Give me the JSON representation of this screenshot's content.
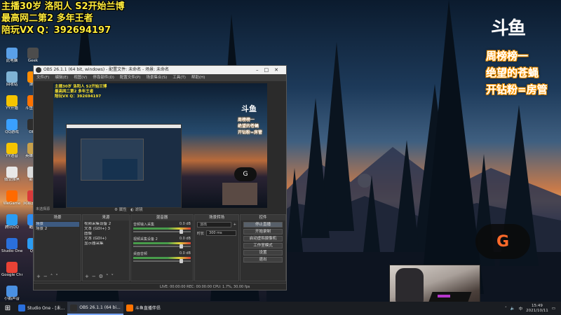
{
  "overlay": {
    "line1": "主播30岁 洛阳人 S2开始兰博",
    "line2": "最高网二第2 多年王者",
    "line3": "陪玩VX Q：392694197",
    "logo": "斗鱼",
    "right_line1": "周榜榜一",
    "right_line2": "绝望的苍蝇",
    "right_line3": "开钻粉=房管",
    "badge_glyph": "G"
  },
  "desktop_icons": [
    {
      "label": "此电脑",
      "color": "#5aa0e8"
    },
    {
      "label": "回收站",
      "color": "#7fb3d5"
    },
    {
      "label": "YY开播",
      "color": "#f5c400"
    },
    {
      "label": "QQ游戏",
      "color": "#3aa0ff"
    },
    {
      "label": "YY语音",
      "color": "#f5c400"
    },
    {
      "label": "微软雅黑",
      "color": "#e8e8e8"
    },
    {
      "label": "WeGame",
      "color": "#ff6a00"
    },
    {
      "label": "腾讯QQ",
      "color": "#2b9cf2"
    },
    {
      "label": "Studio One 2",
      "color": "#2a6fdb"
    },
    {
      "label": "Google Chrome",
      "color": "#e94235"
    },
    {
      "label": "小鹅声音",
      "color": "#4a90e2"
    },
    {
      "label": "Geek",
      "color": "#4c4c4c"
    },
    {
      "label": "弹幕",
      "color": "#ff8c00"
    },
    {
      "label": "斗鱼直播",
      "color": "#ff7300"
    },
    {
      "label": "OBS",
      "color": "#2d2d2d"
    },
    {
      "label": "英雄联盟",
      "color": "#c8a04a"
    },
    {
      "label": "新建",
      "color": "#dcdcdc"
    },
    {
      "label": "网易云音乐",
      "color": "#d83a3a"
    },
    {
      "label": "酷狗",
      "color": "#2d8cf0"
    },
    {
      "label": "QQ",
      "color": "#2b9cf2"
    }
  ],
  "obs": {
    "title": "OBS 26.1.1 (64 bit, windows) - 配置文件: 未命名 - 场景: 未命名",
    "menu": [
      "文件(F)",
      "编辑(E)",
      "视图(V)",
      "停靠部件(D)",
      "配置文件(P)",
      "场景集合(S)",
      "工具(T)",
      "帮助(H)"
    ],
    "no_source": "未选择源",
    "props_label": "属性",
    "filters_label": "滤镜",
    "docks": {
      "scenes": {
        "title": "场景",
        "items": [
          "场景",
          "场景 2"
        ]
      },
      "sources": {
        "title": "来源",
        "items": [
          "视频采集设备 2",
          "文本 (GDI+) 3",
          "图像",
          "文本 (GDI+)",
          "显示器采集"
        ]
      },
      "mixer": {
        "title": "混音器",
        "channels": [
          {
            "name": "音频输入采集",
            "db": "0.0 dB"
          },
          {
            "name": "视频采集设备 2",
            "db": "0.0 dB"
          },
          {
            "name": "桌面音频",
            "db": "0.0 dB"
          }
        ]
      },
      "transitions": {
        "title": "场景转场",
        "type": "淡出",
        "duration_label": "时长",
        "duration": "300 ms"
      },
      "controls": {
        "title": "控件",
        "buttons": [
          "停止直播",
          "开始录制",
          "启动虚拟摄像机",
          "工作室模式",
          "设置",
          "退出"
        ]
      }
    },
    "status": "LIVE: 00:00:00   REC: 00:00:00   CPU: 1.7%, 30.00 fps"
  },
  "taskbar": {
    "items": [
      {
        "label": "Studio One - [未...",
        "color": "#2a6fdb",
        "active": false
      },
      {
        "label": "OBS 26.1.1 (64 bi...",
        "color": "#2d2d2d",
        "active": true
      },
      {
        "label": "斗鱼直播伴侣",
        "color": "#ff7300",
        "active": false
      }
    ],
    "time": "15:49",
    "date": "2021/10/11",
    "ime": "中"
  }
}
